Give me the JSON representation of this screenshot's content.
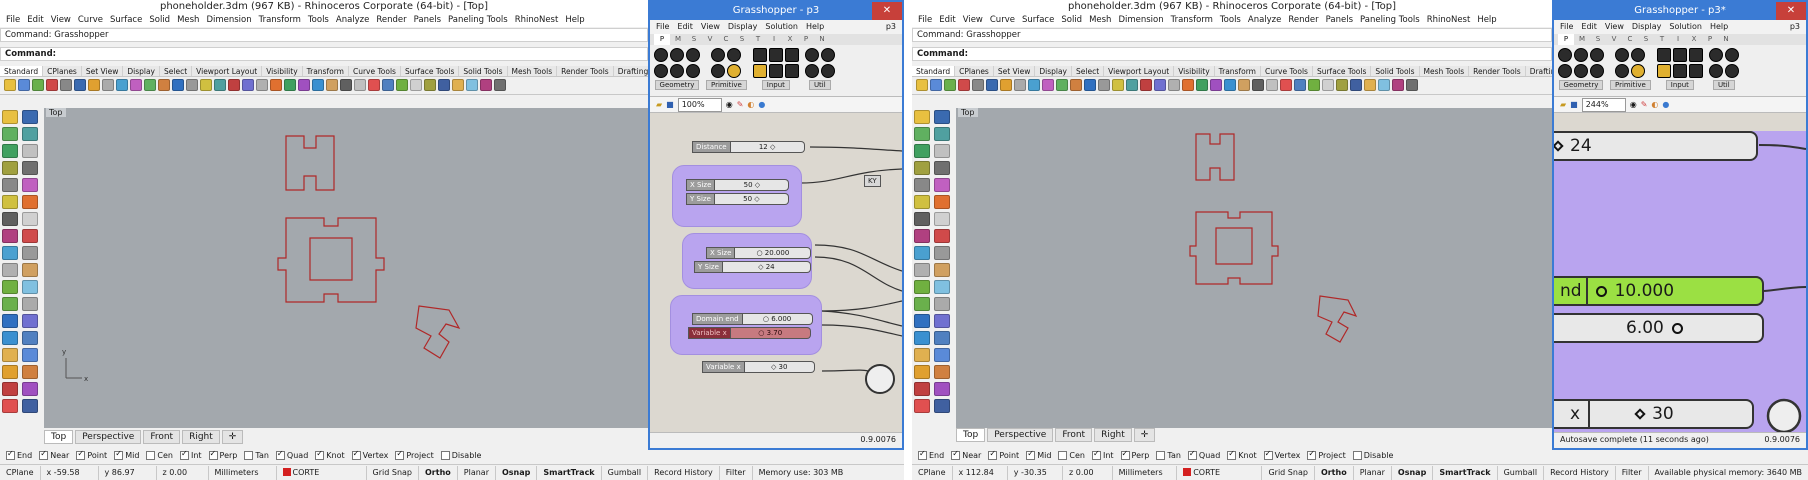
{
  "left": {
    "title": "phoneholder.3dm (967 KB) - Rhinoceros Corporate (64-bit) - [Top]",
    "menu": [
      "File",
      "Edit",
      "View",
      "Curve",
      "Surface",
      "Solid",
      "Mesh",
      "Dimension",
      "Transform",
      "Tools",
      "Analyze",
      "Render",
      "Panels",
      "Paneling Tools",
      "RhinoNest",
      "Help"
    ],
    "command_history": "Command: Grasshopper",
    "command_prompt": "Command:",
    "toolbar_tabs": [
      "Standard",
      "CPlanes",
      "Set View",
      "Display",
      "Select",
      "Viewport Layout",
      "Visibility",
      "Transform",
      "Curve Tools",
      "Surface Tools",
      "Solid Tools",
      "Mesh Tools",
      "Render Tools",
      "Drafting",
      "Ne"
    ],
    "viewport_label": "Top",
    "viewport_tabs": [
      "Top",
      "Perspective",
      "Front",
      "Right"
    ],
    "osnap": [
      "End",
      "Near",
      "Point",
      "Mid",
      "Cen",
      "Int",
      "Perp",
      "Tan",
      "Quad",
      "Knot",
      "Vertex",
      "Project",
      "Disable"
    ],
    "osnap_checked": [
      true,
      true,
      true,
      true,
      false,
      true,
      true,
      false,
      true,
      true,
      true,
      true,
      false
    ],
    "status": {
      "cplane": "CPlane",
      "x": "x -59.58",
      "y": "y 86.97",
      "z": "z 0.00",
      "units": "Millimeters",
      "layer": "CORTE",
      "layer_color": "#d42020",
      "grid_snap": "Grid Snap",
      "ortho": "Ortho",
      "planar": "Planar",
      "osnap": "Osnap",
      "smarttrack": "SmartTrack",
      "gumball": "Gumball",
      "record_history": "Record History",
      "filter": "Filter",
      "memory": "Memory use: 303 MB"
    }
  },
  "right": {
    "title": "phoneholder.3dm (967 KB) - Rhinoceros Corporate (64-bit) - [Top]",
    "command_history": "Command: Grasshopper",
    "command_prompt": "Command:",
    "viewport_label": "Top",
    "viewport_tabs": [
      "Top",
      "Perspective",
      "Front",
      "Right"
    ],
    "status": {
      "cplane": "CPlane",
      "x": "x 112.84",
      "y": "y -30.35",
      "z": "z 0.00",
      "units": "Millimeters",
      "layer": "CORTE",
      "grid_snap": "Grid Snap",
      "ortho": "Ortho",
      "planar": "Planar",
      "osnap": "Osnap",
      "smarttrack": "SmartTrack",
      "gumball": "Gumball",
      "record_history": "Record History",
      "filter": "Filter",
      "memory": "Available physical memory: 3640 MB"
    }
  },
  "gh_left": {
    "title": "Grasshopper - p3",
    "menu": [
      "File",
      "Edit",
      "View",
      "Display",
      "Solution",
      "Help"
    ],
    "doc": "p3",
    "tabs": [
      "P",
      "M",
      "S",
      "V",
      "C",
      "S",
      "T",
      "I",
      "X",
      "P",
      "N"
    ],
    "groups": [
      "Geometry",
      "Primitive",
      "Input",
      "Util"
    ],
    "zoom": "100%",
    "version": "0.9.0076",
    "nodes": [
      {
        "label": "Distance",
        "value": "12 ◇"
      },
      {
        "label": "X Size",
        "value": "50 ◇"
      },
      {
        "label": "Y Size",
        "value": "50 ◇"
      },
      {
        "label": "X Size",
        "value": "○ 20.000"
      },
      {
        "label": "Y Size",
        "value": "◇ 24"
      },
      {
        "label": "Domain end",
        "value": "○ 6.000"
      },
      {
        "label": "Variable x",
        "value": "○ 3.70"
      },
      {
        "label": "Variable x",
        "value": "◇ 30"
      }
    ],
    "partial_node": "KY"
  },
  "gh_right": {
    "title": "Grasshopper - p3*",
    "menu": [
      "File",
      "Edit",
      "View",
      "Display",
      "Solution",
      "Help"
    ],
    "doc": "p3",
    "zoom": "244%",
    "version": "0.9.0076",
    "autosave": "Autosave complete (11 seconds ago)",
    "big_nodes": [
      {
        "prefix": "",
        "value": "24"
      },
      {
        "prefix": "nd",
        "value": "10.000"
      },
      {
        "prefix": "",
        "value": "6.00"
      },
      {
        "prefix": "x",
        "value": "30"
      }
    ]
  }
}
